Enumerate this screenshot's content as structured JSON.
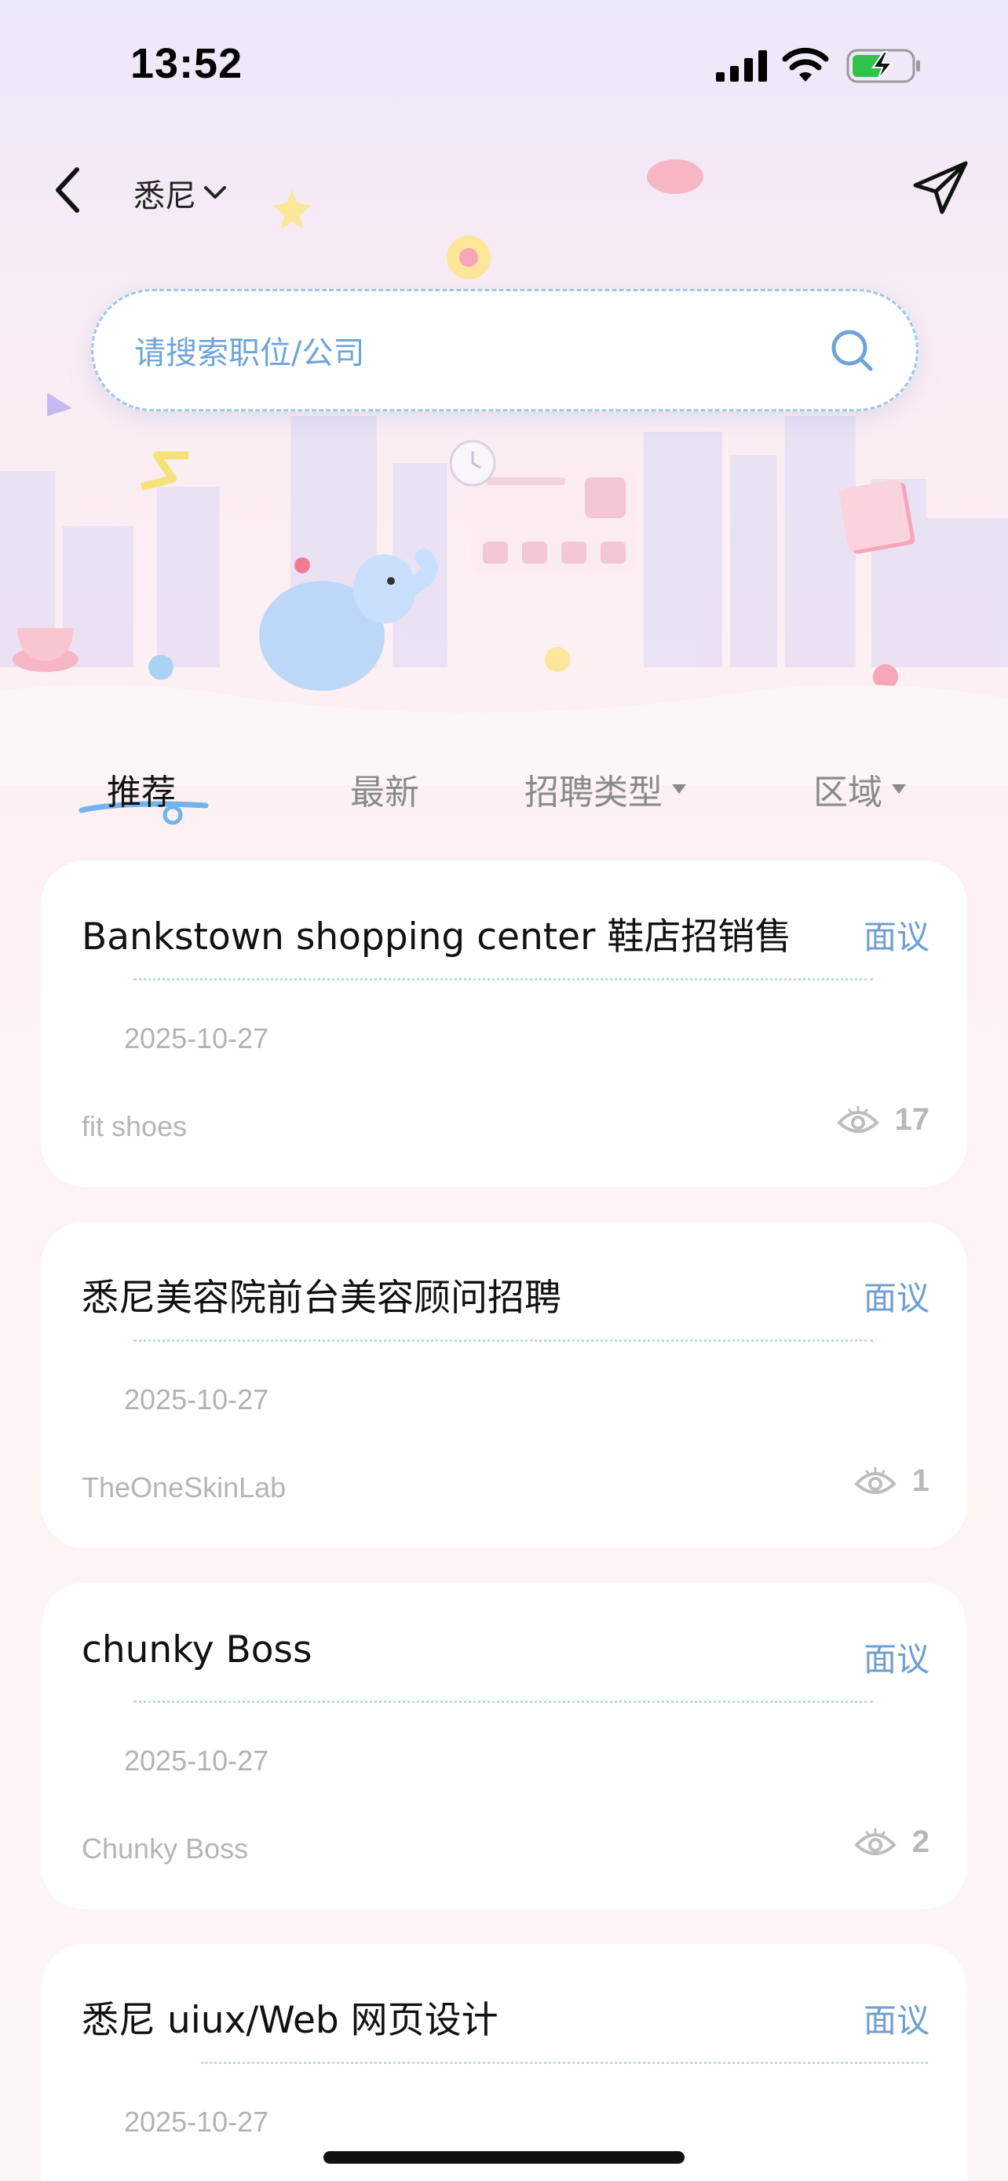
{
  "status_bar": {
    "time": "13:52",
    "icons": [
      "signal-icon",
      "wifi-icon",
      "battery-charging-icon"
    ]
  },
  "header": {
    "city": "悉尼",
    "icons": [
      "back-icon",
      "chevron-down-icon",
      "paper-plane-icon"
    ]
  },
  "search": {
    "placeholder": "请搜索职位/公司",
    "icon": "search-icon"
  },
  "tabs": [
    {
      "label": "推荐",
      "active": true
    },
    {
      "label": "最新",
      "active": false
    },
    {
      "label": "招聘类型",
      "active": false,
      "dropdown": true
    },
    {
      "label": "区域",
      "active": false,
      "dropdown": true
    }
  ],
  "jobs": [
    {
      "title": "Bankstown shopping center 鞋店招销售",
      "salary": "面议",
      "date": "2025-10-27",
      "company": "fit shoes",
      "views": "17"
    },
    {
      "title": "悉尼美容院前台美容顾问招聘",
      "salary": "面议",
      "date": "2025-10-27",
      "company": "TheOneSkinLab",
      "views": "1"
    },
    {
      "title": "chunky Boss",
      "salary": "面议",
      "date": "2025-10-27",
      "company": "Chunky Boss",
      "views": "2"
    },
    {
      "title": "悉尼 uiux/Web 网页设计",
      "salary": "面议",
      "date": "2025-10-27",
      "company": "",
      "views": ""
    }
  ],
  "colors": {
    "accent_blue": "#6e9fd0",
    "search_border": "#9cc8ee",
    "muted_text": "#b5b5b5"
  }
}
